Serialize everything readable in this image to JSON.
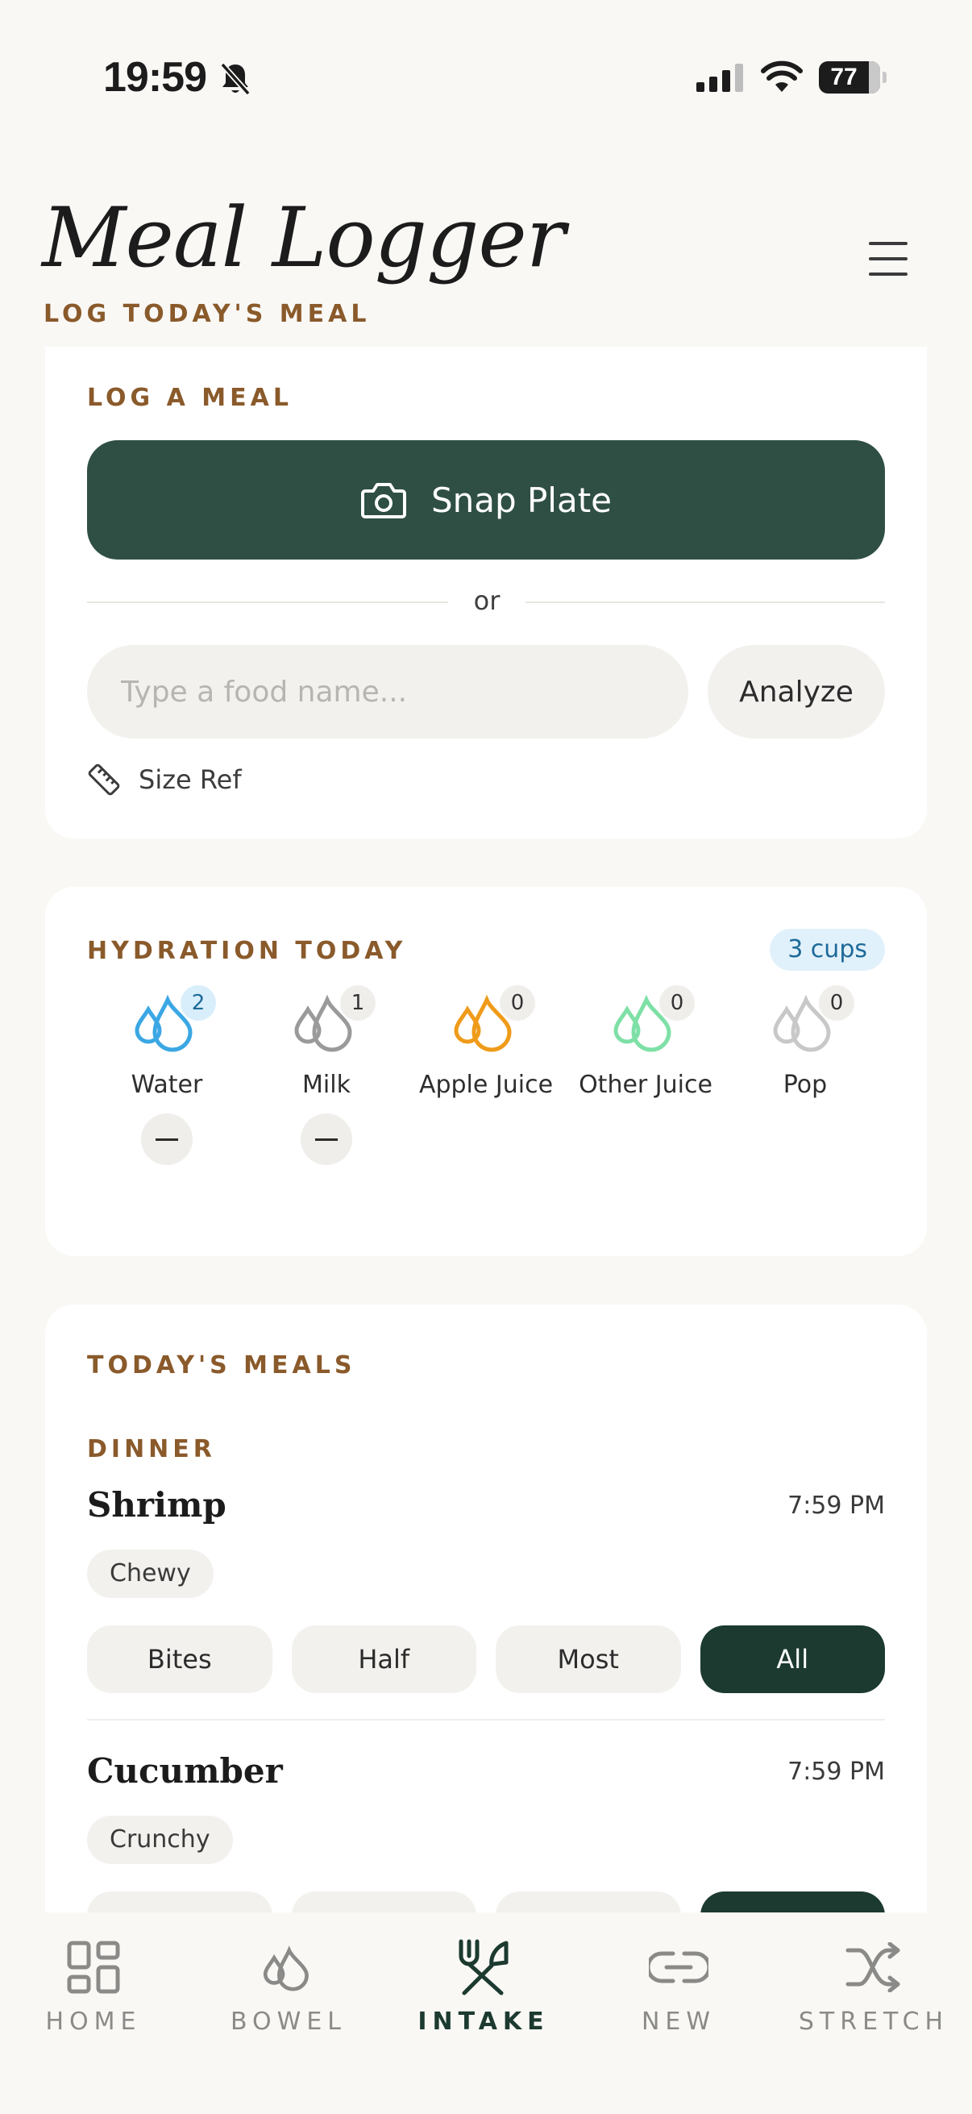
{
  "status": {
    "time": "19:59",
    "battery": "77"
  },
  "header": {
    "title": "Meal Logger",
    "subtitle": "LOG TODAY'S MEAL"
  },
  "log_meal": {
    "section_label": "LOG A MEAL",
    "snap_label": "Snap Plate",
    "or_text": "or",
    "food_placeholder": "Type a food name...",
    "food_value": "",
    "analyze_label": "Analyze",
    "size_ref_label": "Size Ref"
  },
  "hydration": {
    "section_label": "HYDRATION TODAY",
    "total_badge": "3 cups",
    "drinks": [
      {
        "name": "Water",
        "count": "2",
        "color": "#3ba7e4"
      },
      {
        "name": "Milk",
        "count": "1",
        "color": "#9a9a9a"
      },
      {
        "name": "Apple Juice",
        "count": "0",
        "color": "#ef9b1a"
      },
      {
        "name": "Other Juice",
        "count": "0",
        "color": "#7ee0a6"
      },
      {
        "name": "Pop",
        "count": "0",
        "color": "#c8c8c8"
      }
    ]
  },
  "meals": {
    "section_label": "TODAY'S MEALS",
    "category": "DINNER",
    "items": [
      {
        "name": "Shrimp",
        "time": "7:59 PM",
        "texture": "Chewy",
        "portion": "All"
      },
      {
        "name": "Cucumber",
        "time": "7:59 PM",
        "texture": "Crunchy",
        "portion": "All"
      }
    ],
    "portion_options": [
      "Bites",
      "Half",
      "Most",
      "All"
    ]
  },
  "nav": {
    "items": [
      {
        "label": "HOME",
        "icon": "grid-icon"
      },
      {
        "label": "BOWEL",
        "icon": "drops-icon"
      },
      {
        "label": "INTAKE",
        "icon": "utensils-icon"
      },
      {
        "label": "NEW",
        "icon": "link-icon"
      },
      {
        "label": "STRETCH",
        "icon": "shuffle-icon"
      }
    ],
    "active": "INTAKE"
  },
  "colors": {
    "accent_green": "#2f4f44",
    "dark_green": "#1c3a30",
    "label_brown": "#8a5a2b",
    "water_blue": "#3ba7e4"
  }
}
